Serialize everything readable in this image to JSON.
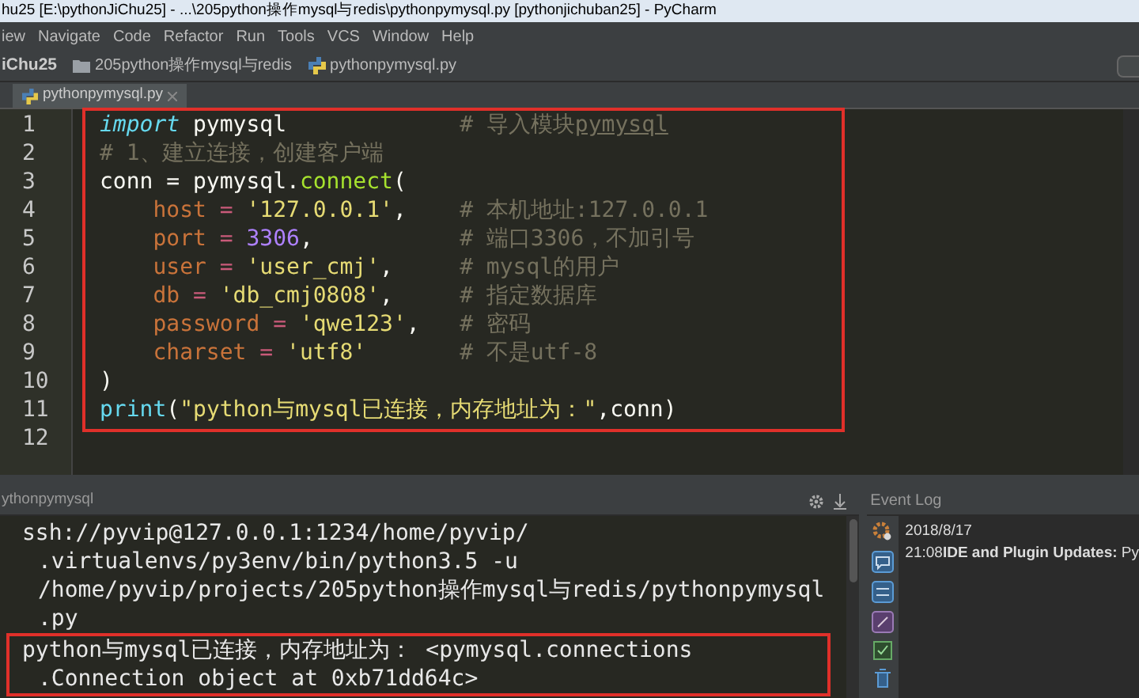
{
  "window": {
    "title": "hu25 [E:\\pythonJiChu25] - ...\\205python操作mysql与redis\\pythonpymysql.py [pythonjichuban25] - PyCharm"
  },
  "menu": [
    "iew",
    "Navigate",
    "Code",
    "Refactor",
    "Run",
    "Tools",
    "VCS",
    "Window",
    "Help"
  ],
  "breadcrumbs": [
    {
      "kind": "project",
      "label": "iChu25"
    },
    {
      "kind": "folder",
      "label": "205python操作mysql与redis"
    },
    {
      "kind": "python",
      "label": "pythonpymysql.py"
    }
  ],
  "tabs": [
    {
      "label": "pythonpymysql.py",
      "selected": true
    }
  ],
  "editor": {
    "lines": [
      {
        "number": "1",
        "highlighted": true,
        "tokens": [
          {
            "kind": "keyword",
            "text": "import"
          },
          {
            "kind": "plain",
            "text": " pymysql"
          }
        ],
        "comment": [
          {
            "kind": "comment",
            "text": "# 导入模块"
          },
          {
            "kind": "comment_typo",
            "text": "pymysql"
          }
        ]
      },
      {
        "number": "2",
        "highlighted": true,
        "tokens": [
          {
            "kind": "comment",
            "text": "# 1、建立连接，创建客户端"
          }
        ]
      },
      {
        "number": "3",
        "highlighted": true,
        "tokens": [
          {
            "kind": "plain",
            "text": "conn = pymysql."
          },
          {
            "kind": "function",
            "text": "connect"
          },
          {
            "kind": "plain",
            "text": "("
          }
        ]
      },
      {
        "number": "4",
        "highlighted": true,
        "tokens": [
          {
            "kind": "param",
            "text": "    host"
          },
          {
            "kind": "operator",
            "text": " = "
          },
          {
            "kind": "string",
            "text": "'127.0.0.1'"
          },
          {
            "kind": "plain",
            "text": ","
          }
        ],
        "comment": [
          {
            "kind": "comment",
            "text": "# 本机地址:127.0.0.1"
          }
        ]
      },
      {
        "number": "5",
        "highlighted": true,
        "tokens": [
          {
            "kind": "param",
            "text": "    port"
          },
          {
            "kind": "operator",
            "text": " = "
          },
          {
            "kind": "number",
            "text": "3306"
          },
          {
            "kind": "plain",
            "text": ","
          }
        ],
        "comment": [
          {
            "kind": "comment",
            "text": "# 端口3306，不加引号"
          }
        ]
      },
      {
        "number": "6",
        "highlighted": true,
        "tokens": [
          {
            "kind": "param",
            "text": "    user"
          },
          {
            "kind": "operator",
            "text": " = "
          },
          {
            "kind": "string",
            "text": "'user_cmj'"
          },
          {
            "kind": "plain",
            "text": ","
          }
        ],
        "comment": [
          {
            "kind": "comment",
            "text": "# mysql的用户"
          }
        ]
      },
      {
        "number": "7",
        "highlighted": true,
        "tokens": [
          {
            "kind": "param",
            "text": "    db"
          },
          {
            "kind": "operator",
            "text": " = "
          },
          {
            "kind": "string",
            "text": "'db_cmj0808'"
          },
          {
            "kind": "plain",
            "text": ","
          }
        ],
        "comment": [
          {
            "kind": "comment",
            "text": "# 指定数据库"
          }
        ]
      },
      {
        "number": "8",
        "highlighted": true,
        "tokens": [
          {
            "kind": "param",
            "text": "    password"
          },
          {
            "kind": "operator",
            "text": " = "
          },
          {
            "kind": "string",
            "text": "'qwe123'"
          },
          {
            "kind": "plain",
            "text": ","
          }
        ],
        "comment": [
          {
            "kind": "comment",
            "text": "# 密码"
          }
        ]
      },
      {
        "number": "9",
        "highlighted": true,
        "tokens": [
          {
            "kind": "param",
            "text": "    charset"
          },
          {
            "kind": "operator",
            "text": " = "
          },
          {
            "kind": "string",
            "text": "'utf8'"
          }
        ],
        "comment": [
          {
            "kind": "comment",
            "text": "# 不是utf-8"
          }
        ]
      },
      {
        "number": "10",
        "highlighted": true,
        "tokens": [
          {
            "kind": "plain",
            "text": ")"
          }
        ]
      },
      {
        "number": "11",
        "highlighted": true,
        "tokens": [
          {
            "kind": "builtin",
            "text": "print"
          },
          {
            "kind": "plain",
            "text": "("
          },
          {
            "kind": "string",
            "text": "\"python与mysql已连接，内存地址为：\""
          },
          {
            "kind": "plain",
            "text": ",conn)"
          }
        ]
      },
      {
        "number": "12",
        "highlighted": false
      }
    ]
  },
  "run_panel": {
    "title": "ythonpymysql",
    "console": [
      {
        "text": "ssh://pyvip@127.0.0.1:1234/home/pyvip/",
        "continuation": false,
        "highlighted": false
      },
      {
        "text": ".virtualenvs/py3env/bin/python3.5 -u",
        "continuation": true,
        "highlighted": false
      },
      {
        "text": "/home/pyvip/projects/205python操作mysql与redis/pythonpymysql",
        "continuation": true,
        "highlighted": false
      },
      {
        "text": ".py",
        "continuation": true,
        "highlighted": false
      },
      {
        "text": "python与mysql已连接，内存地址为： <pymysql.connections",
        "continuation": false,
        "highlighted": true
      },
      {
        "text": ".Connection object at 0xb71dd64c>",
        "continuation": true,
        "highlighted": true
      }
    ]
  },
  "event_log": {
    "title": "Event Log",
    "entries": [
      {
        "date": "2018/8/17",
        "message": "21:08**IDE and Plugin Updates:** Py"
      }
    ]
  }
}
